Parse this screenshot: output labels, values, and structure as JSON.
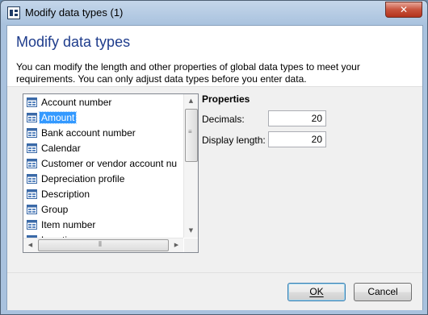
{
  "window": {
    "title": "Modify data types (1)",
    "close_glyph": "✕"
  },
  "dialog": {
    "heading": "Modify data types",
    "description": "You can modify the length and other properties of global data types to meet your requirements. You can only adjust data types before you enter data."
  },
  "list": {
    "items": [
      {
        "label": "Account number",
        "selected": false
      },
      {
        "label": "Amount",
        "selected": true
      },
      {
        "label": "Bank account number",
        "selected": false
      },
      {
        "label": "Calendar",
        "selected": false
      },
      {
        "label": "Customer or vendor account nu",
        "selected": false
      },
      {
        "label": "Depreciation profile",
        "selected": false
      },
      {
        "label": "Description",
        "selected": false
      },
      {
        "label": "Group",
        "selected": false
      },
      {
        "label": "Item number",
        "selected": false
      },
      {
        "label": "Location",
        "selected": false
      }
    ],
    "item_icon": "data-type-icon"
  },
  "properties": {
    "title": "Properties",
    "decimals_label": "Decimals:",
    "decimals_value": "20",
    "display_length_label": "Display length:",
    "display_length_value": "20"
  },
  "buttons": {
    "ok": "OK",
    "cancel": "Cancel"
  },
  "colors": {
    "heading": "#1e3c8c",
    "selection": "#3399ff"
  }
}
